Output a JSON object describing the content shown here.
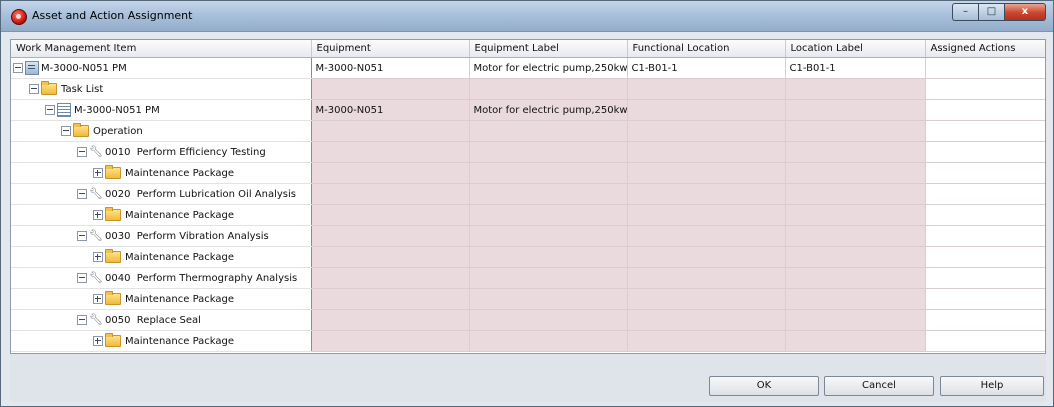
{
  "window": {
    "title": "Asset and Action Assignment",
    "caption": {
      "minimize": "–",
      "maximize": "□",
      "close": "x"
    }
  },
  "grid": {
    "columns": [
      "Work Management Item",
      "Equipment",
      "Equipment Label",
      "Functional Location",
      "Location Label",
      "Assigned Actions"
    ],
    "rows": [
      {
        "label": "M-3000-N051 PM",
        "icon": "work-item-icon",
        "equipment": "M-3000-N051",
        "equipment_label": "Motor for electric pump,250kw",
        "functional_location": "C1-B01-1",
        "location_label": "C1-B01-1",
        "assigned_actions": ""
      },
      {
        "label": "Task List",
        "icon": "folder-icon",
        "equipment": "",
        "equipment_label": "",
        "functional_location": "",
        "location_label": "",
        "assigned_actions": ""
      },
      {
        "label": "M-3000-N051 PM",
        "icon": "task-list-icon",
        "equipment": "M-3000-N051",
        "equipment_label": "Motor for electric pump,250kw",
        "functional_location": "",
        "location_label": "",
        "assigned_actions": ""
      },
      {
        "label": "Operation",
        "icon": "folder-icon",
        "equipment": "",
        "equipment_label": "",
        "functional_location": "",
        "location_label": "",
        "assigned_actions": ""
      },
      {
        "label": "0010  Perform Efficiency Testing",
        "icon": "wrench-icon",
        "equipment": "",
        "equipment_label": "",
        "functional_location": "",
        "location_label": "",
        "assigned_actions": ""
      },
      {
        "label": "Maintenance Package",
        "icon": "folder-icon",
        "equipment": "",
        "equipment_label": "",
        "functional_location": "",
        "location_label": "",
        "assigned_actions": ""
      },
      {
        "label": "0020  Perform Lubrication Oil Analysis",
        "icon": "wrench-icon",
        "equipment": "",
        "equipment_label": "",
        "functional_location": "",
        "location_label": "",
        "assigned_actions": ""
      },
      {
        "label": "Maintenance Package",
        "icon": "folder-icon",
        "equipment": "",
        "equipment_label": "",
        "functional_location": "",
        "location_label": "",
        "assigned_actions": ""
      },
      {
        "label": "0030  Perform Vibration Analysis",
        "icon": "wrench-icon",
        "equipment": "",
        "equipment_label": "",
        "functional_location": "",
        "location_label": "",
        "assigned_actions": ""
      },
      {
        "label": "Maintenance Package",
        "icon": "folder-icon",
        "equipment": "",
        "equipment_label": "",
        "functional_location": "",
        "location_label": "",
        "assigned_actions": ""
      },
      {
        "label": "0040  Perform Thermography Analysis",
        "icon": "wrench-icon",
        "equipment": "",
        "equipment_label": "",
        "functional_location": "",
        "location_label": "",
        "assigned_actions": ""
      },
      {
        "label": "Maintenance Package",
        "icon": "folder-icon",
        "equipment": "",
        "equipment_label": "",
        "functional_location": "",
        "location_label": "",
        "assigned_actions": ""
      },
      {
        "label": "0050  Replace Seal",
        "icon": "wrench-icon",
        "equipment": "",
        "equipment_label": "",
        "functional_location": "",
        "location_label": "",
        "assigned_actions": ""
      },
      {
        "label": "Maintenance Package",
        "icon": "folder-icon",
        "equipment": "",
        "equipment_label": "",
        "functional_location": "",
        "location_label": "",
        "assigned_actions": ""
      }
    ]
  },
  "buttons": {
    "ok": "OK",
    "cancel": "Cancel",
    "help": "Help"
  }
}
